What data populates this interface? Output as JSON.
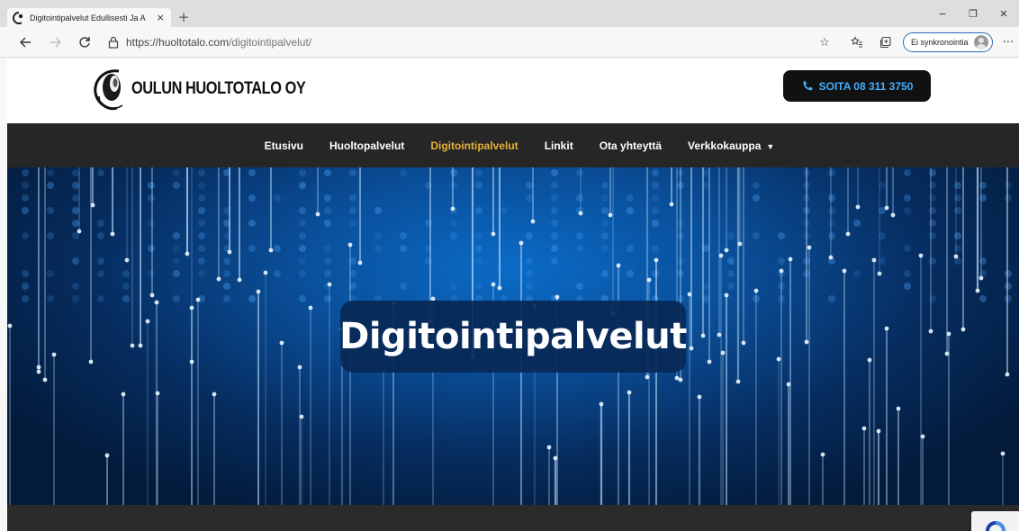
{
  "browser": {
    "tab": {
      "title": "Digitointipalvelut Edullisesti Ja A",
      "close_label": "×"
    },
    "new_tab_label": "+",
    "window_controls": {
      "minimize": "−",
      "maximize": "❐",
      "close": "✕"
    },
    "address": {
      "scheme_host": "https://huoltotalo.com",
      "path": "/digitointipalvelut/"
    },
    "profile": {
      "sync_label": "Ei synkronointia"
    },
    "more_label": "···"
  },
  "site": {
    "logo_text": "OULUN HUOLTOTALO OY",
    "call_button": "SOITA 08 311 3750",
    "menu": [
      {
        "label": "Etusivu",
        "active": false
      },
      {
        "label": "Huoltopalvelut",
        "active": false
      },
      {
        "label": "Digitointipalvelut",
        "active": true
      },
      {
        "label": "Linkit",
        "active": false
      },
      {
        "label": "Ota yhteyttä",
        "active": false
      },
      {
        "label": "Verkkokauppa",
        "active": false,
        "dropdown": true
      }
    ],
    "hero_title": "Digitointipalvelut"
  },
  "colors": {
    "menu_bg": "#262626",
    "menu_active": "#e8b23a",
    "call_text": "#3fb1ff",
    "hero_box": "#082855"
  }
}
